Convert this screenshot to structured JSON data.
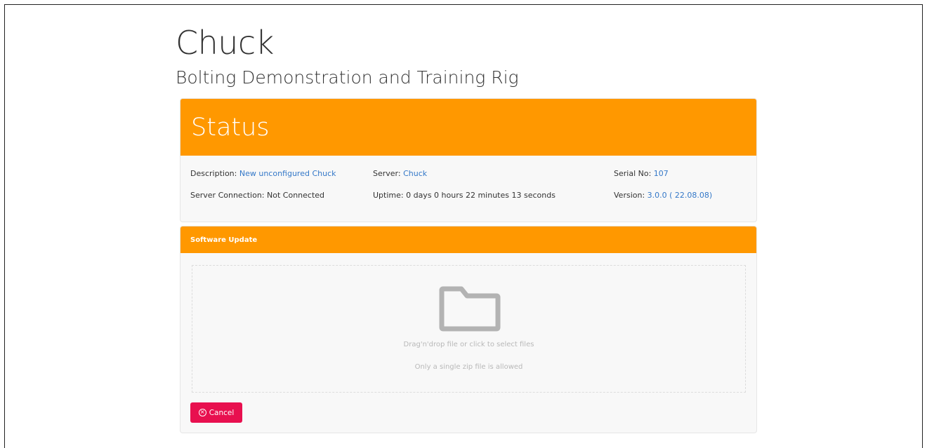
{
  "app": {
    "title": "Chuck",
    "subtitle": "Bolting Demonstration and Training Rig"
  },
  "status": {
    "heading": "Status",
    "description_label": "Description:",
    "description_value": "New unconfigured Chuck",
    "server_label": "Server:",
    "server_value": "Chuck",
    "serial_label": "Serial No:",
    "serial_value": "107",
    "connection_label": "Server Connection:",
    "connection_value": "Not Connected",
    "uptime_label": "Uptime:",
    "uptime_value": "0 days 0 hours 22 minutes 13 seconds",
    "version_label": "Version:",
    "version_value": "3.0.0 ( 22.08.08)"
  },
  "software_update": {
    "heading": "Software Update",
    "dropzone_text": "Drag'n'drop file or click to select files",
    "dropzone_hint": "Only a single zip file is allowed",
    "cancel_label": "Cancel",
    "icons": {
      "dropzone": "folder-icon",
      "cancel": "x-circle-icon"
    }
  },
  "colors": {
    "accent": "#ff9800",
    "link": "#3478c8",
    "danger": "#e8104f",
    "card_bg": "#f8f8f8"
  }
}
